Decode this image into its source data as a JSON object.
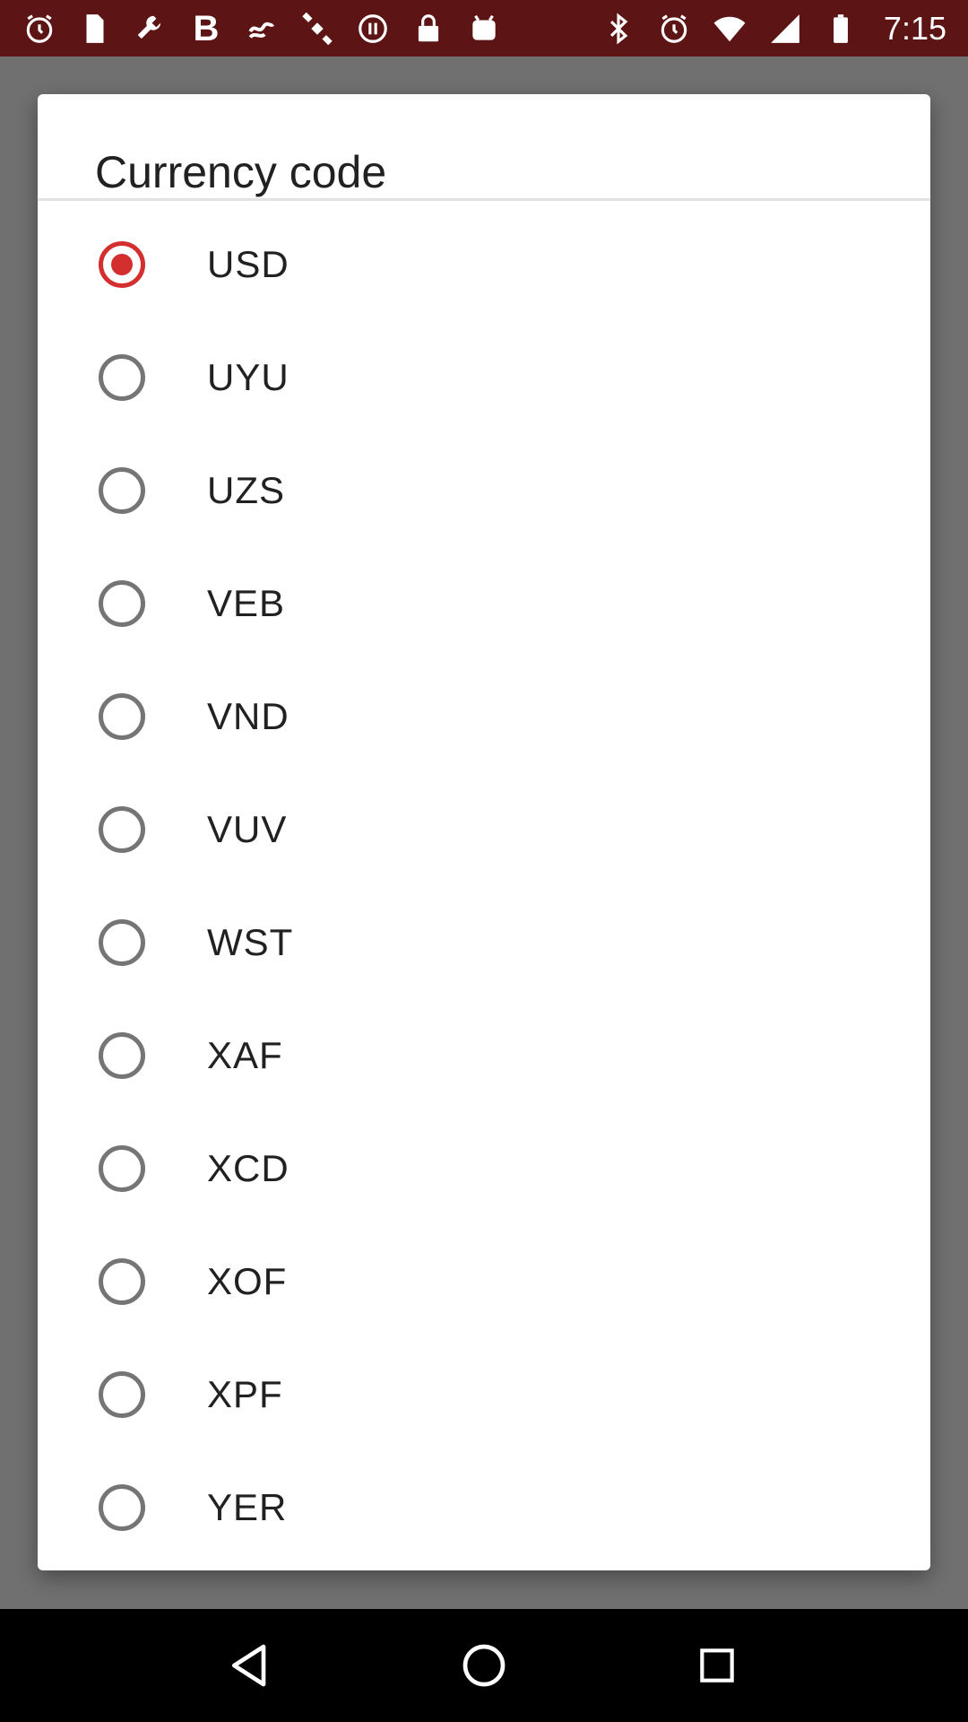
{
  "status_bar": {
    "time": "7:15",
    "left_icons": [
      "alarm-icon",
      "file-icon",
      "wrench-icon",
      "bold-b-icon",
      "swirl-icon",
      "satellite-icon",
      "no-entry-icon",
      "lock-icon",
      "android-icon"
    ],
    "right_icons": [
      "bluetooth-icon",
      "alarm-icon",
      "wifi-icon",
      "signal-icon",
      "battery-icon"
    ],
    "bold_letter": "B"
  },
  "dialog": {
    "title": "Currency code",
    "selected_color": "#d32f2f",
    "options": [
      {
        "label": "USD",
        "selected": true
      },
      {
        "label": "UYU",
        "selected": false
      },
      {
        "label": "UZS",
        "selected": false
      },
      {
        "label": "VEB",
        "selected": false
      },
      {
        "label": "VND",
        "selected": false
      },
      {
        "label": "VUV",
        "selected": false
      },
      {
        "label": "WST",
        "selected": false
      },
      {
        "label": "XAF",
        "selected": false
      },
      {
        "label": "XCD",
        "selected": false
      },
      {
        "label": "XOF",
        "selected": false
      },
      {
        "label": "XPF",
        "selected": false
      },
      {
        "label": "YER",
        "selected": false
      }
    ]
  },
  "nav_bar": {
    "buttons": [
      "back-icon",
      "home-icon",
      "recents-icon"
    ]
  }
}
